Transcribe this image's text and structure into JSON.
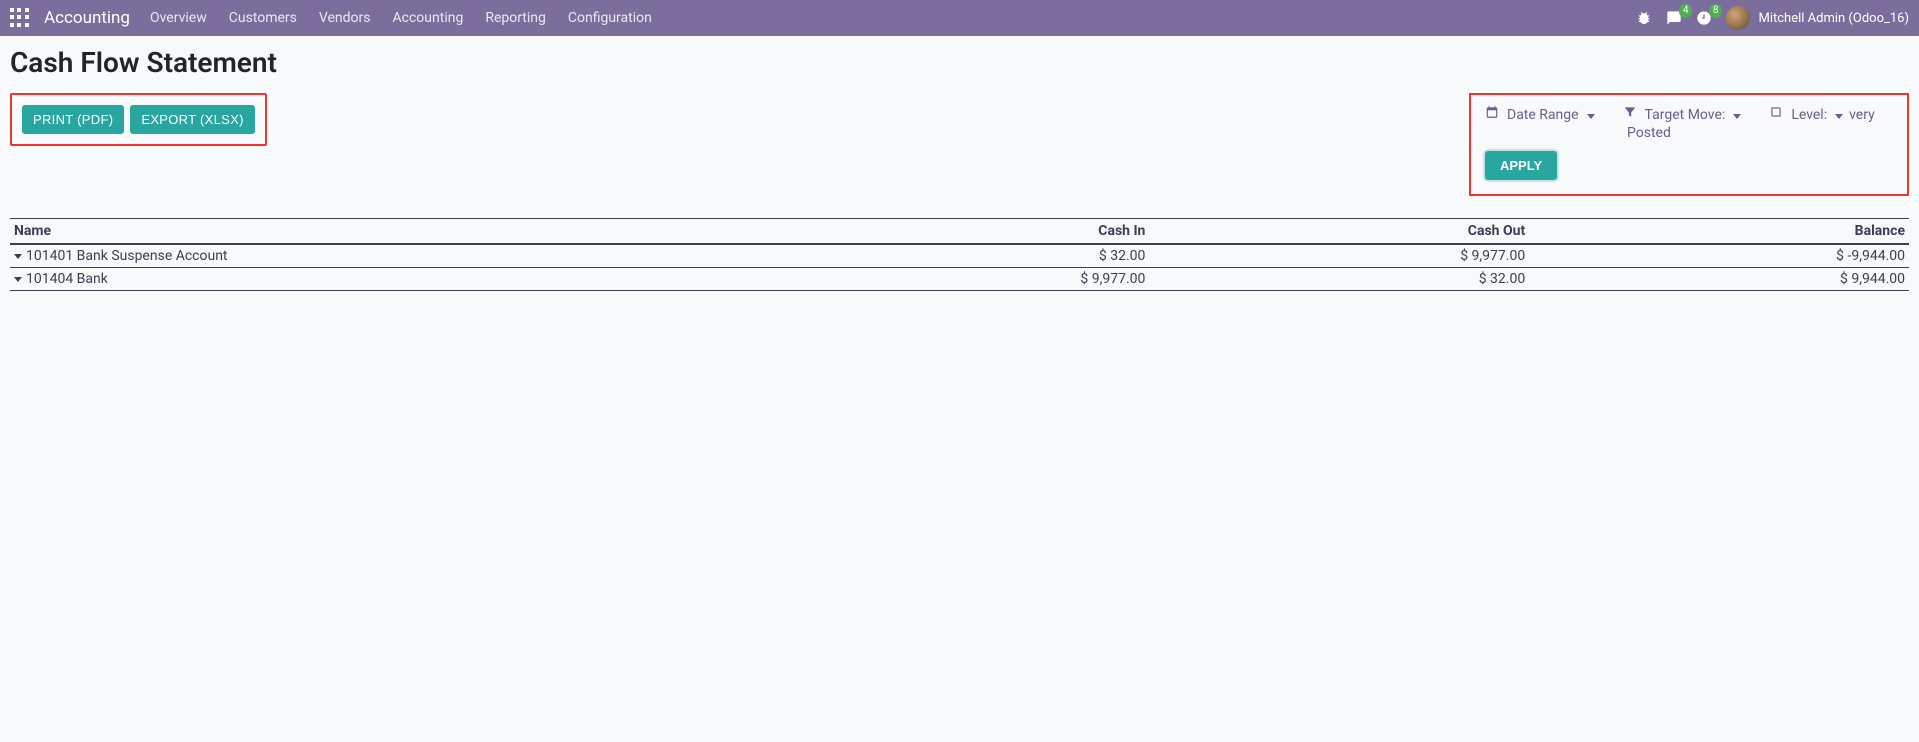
{
  "navbar": {
    "brand": "Accounting",
    "links": [
      "Overview",
      "Customers",
      "Vendors",
      "Accounting",
      "Reporting",
      "Configuration"
    ],
    "messages_count": "4",
    "activities_count": "8",
    "user": "Mitchell Admin (Odoo_16)"
  },
  "page": {
    "title": "Cash Flow Statement"
  },
  "buttons": {
    "print_pdf": "PRINT (PDF)",
    "export_xlsx": "EXPORT (XLSX)",
    "apply": "APPLY"
  },
  "filters": {
    "date_range_label": "Date Range",
    "target_move_label": "Target Move:",
    "target_move_value": "Posted",
    "level_label": "Level:",
    "level_value": "very"
  },
  "table": {
    "headers": {
      "name": "Name",
      "cash_in": "Cash In",
      "cash_out": "Cash Out",
      "balance": "Balance"
    },
    "rows": [
      {
        "name": "101401 Bank Suspense Account",
        "cash_in": "$ 32.00",
        "cash_out": "$ 9,977.00",
        "balance": "$ -9,944.00"
      },
      {
        "name": "101404 Bank",
        "cash_in": "$ 9,977.00",
        "cash_out": "$ 32.00",
        "balance": "$ 9,944.00"
      }
    ]
  }
}
